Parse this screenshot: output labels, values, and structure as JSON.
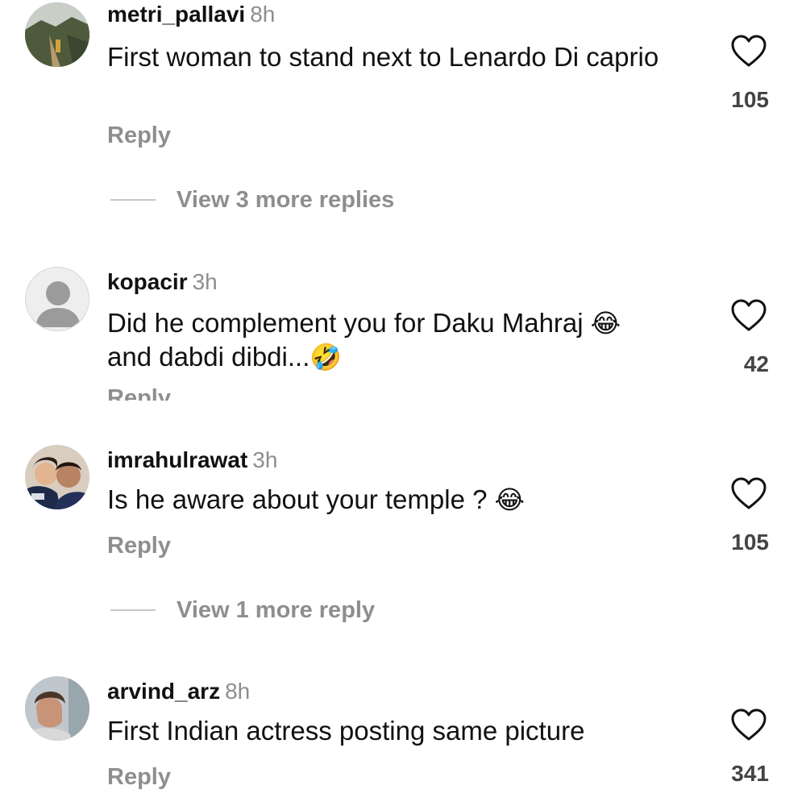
{
  "comments": [
    {
      "username": "metri_pallavi",
      "time": "8h",
      "text": "First woman to stand next to Lenardo Di caprio",
      "likes": "105",
      "reply_label": "Reply",
      "view_more": "View 3 more replies",
      "avatar_icon": "landscape-photo-avatar"
    },
    {
      "username": "kopacir",
      "time": "3h",
      "text": "Did he complement you for Daku Mahraj",
      "text_line2": "and dabdi dibdi...",
      "emoji1": "😂",
      "emoji2": "🤣",
      "likes": "42",
      "reply_label": "Reply",
      "avatar_icon": "default-person-avatar"
    },
    {
      "username": "imrahulrawat",
      "time": "3h",
      "text": "Is he aware about your temple ?",
      "emoji1": "😂",
      "likes": "105",
      "reply_label": "Reply",
      "view_more": "View 1 more reply",
      "avatar_icon": "photo-avatar"
    },
    {
      "username": "arvind_arz",
      "time": "8h",
      "text": "First Indian actress posting same picture",
      "likes": "341",
      "reply_label": "Reply",
      "avatar_icon": "photo-avatar"
    }
  ],
  "colors": {
    "text": "#111111",
    "muted": "#8e8e8e",
    "divider": "#c7c7c7"
  }
}
